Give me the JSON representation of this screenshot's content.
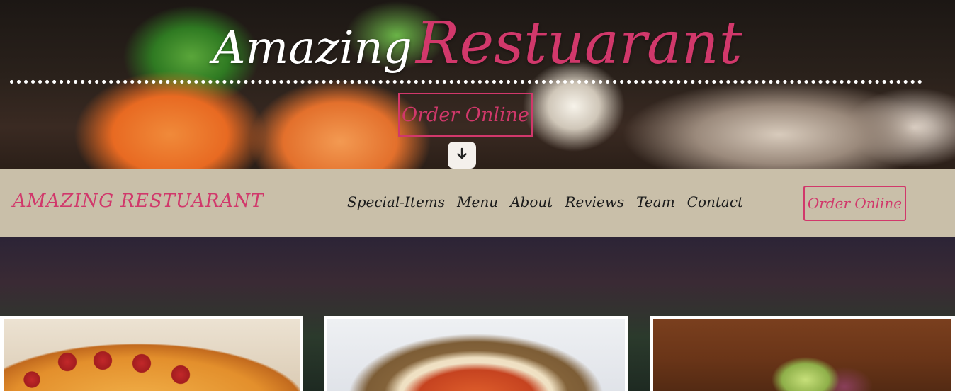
{
  "hero": {
    "title_part1": "Amazing",
    "title_part2": "Restuarant",
    "order_button": "Order Online",
    "scroll_icon": "arrow-down-icon"
  },
  "navbar": {
    "brand": "AMAZING RESTUARANT",
    "links": [
      "Special-Items",
      "Menu",
      "About",
      "Reviews",
      "Team",
      "Contact"
    ],
    "order_button": "Order Online"
  },
  "colors": {
    "accent": "#d1386b",
    "navbar_bg": "#c9bfa9",
    "nav_text": "#1c1c1c"
  },
  "cards": [
    {
      "image": "pizza"
    },
    {
      "image": "pasta-bake"
    },
    {
      "image": "salad"
    }
  ]
}
